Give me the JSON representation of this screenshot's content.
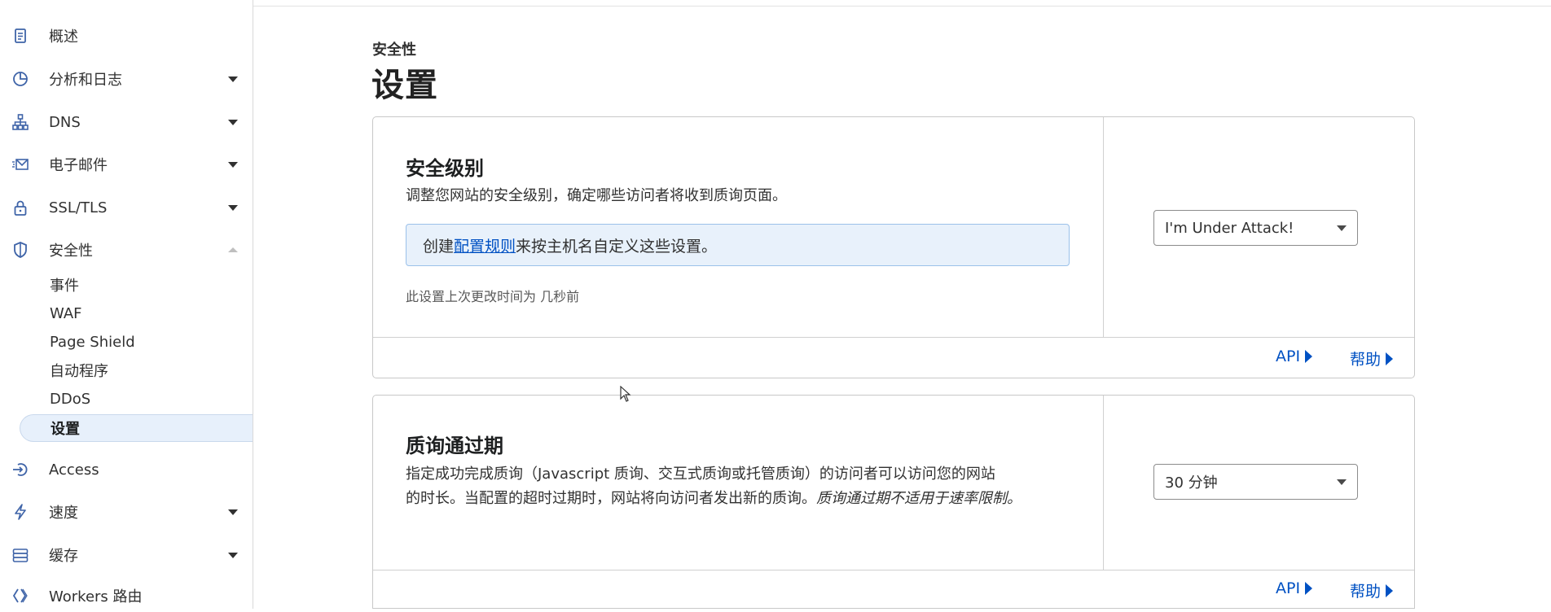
{
  "sidebar": {
    "items": [
      {
        "label": "概述",
        "icon": "clipboard-icon"
      },
      {
        "label": "分析和日志",
        "icon": "pie-chart-icon"
      },
      {
        "label": "DNS",
        "icon": "network-icon"
      },
      {
        "label": "电子邮件",
        "icon": "mail-icon"
      },
      {
        "label": "SSL/TLS",
        "icon": "lock-icon"
      },
      {
        "label": "安全性",
        "icon": "shield-icon"
      },
      {
        "label": "Access",
        "icon": "access-icon"
      },
      {
        "label": "速度",
        "icon": "bolt-icon"
      },
      {
        "label": "缓存",
        "icon": "cache-icon"
      },
      {
        "label": "Workers 路由",
        "icon": "workers-icon"
      }
    ],
    "security_sub": [
      {
        "label": "事件"
      },
      {
        "label": "WAF"
      },
      {
        "label": "Page Shield"
      },
      {
        "label": "自动程序"
      },
      {
        "label": "DDoS"
      },
      {
        "label": "设置"
      }
    ]
  },
  "header": {
    "eyebrow": "安全性",
    "title": "设置"
  },
  "security_level_card": {
    "title": "安全级别",
    "description": "调整您网站的安全级别，确定哪些访问者将收到质询页面。",
    "banner_prefix": "创建",
    "banner_link": "配置规则",
    "banner_suffix": "来按主机名自定义这些设置。",
    "last_modified": "此设置上次更改时间为 几秒前",
    "select_value": "I'm Under Attack!",
    "api_label": "API",
    "help_label": "帮助"
  },
  "challenge_card": {
    "title": "质询通过期",
    "description_line1": "指定成功完成质询（Javascript 质询、交互式质询或托管质询）的访问者可以访问您的网站",
    "description_line2": "的时长。当配置的超时过期时，网站将向访问者发出新的质询。",
    "description_italic": "质询通过期不适用于速率限制。",
    "select_value": "30 分钟",
    "api_label": "API",
    "help_label": "帮助"
  },
  "colors": {
    "accent": "#0051c3",
    "active_bg": "#e7f0fb",
    "banner_bg": "#e8f1fb"
  }
}
